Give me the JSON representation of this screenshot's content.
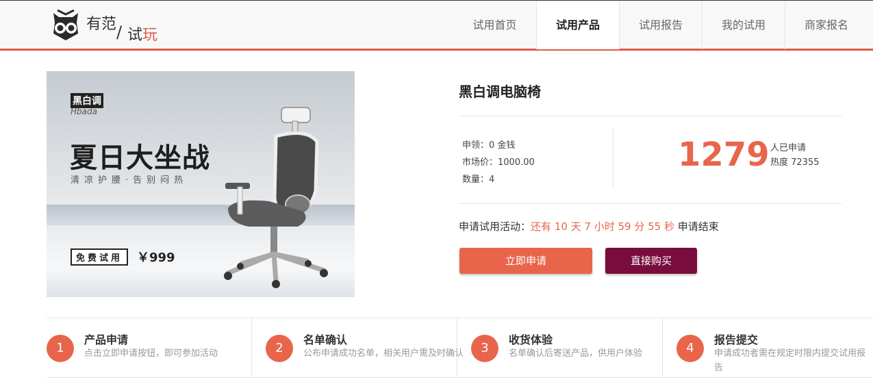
{
  "header": {
    "logo": {
      "text1": "有范",
      "slash": "/",
      "text2a": "试",
      "text2b": "玩"
    },
    "nav": [
      {
        "label": "试用首页"
      },
      {
        "label": "试用产品"
      },
      {
        "label": "试用报告"
      },
      {
        "label": "我的试用"
      },
      {
        "label": "商家报名"
      }
    ]
  },
  "banner": {
    "brand_cn": "黑白调",
    "brand_en": "Hbada",
    "headline": "夏日大坐战",
    "subline": "清凉护腰·告别闷热",
    "free_tag": "免费试用",
    "price": "￥999"
  },
  "product": {
    "title": "黑白调电脑椅",
    "apply_cost": "申领：0 金钱",
    "market_price": "市场价：1000.00",
    "quantity": "数量：4",
    "applicants": "1279",
    "applicants_label": "人已申请",
    "heat": "热度 72355",
    "countdown_prefix": "申请试用活动：",
    "countdown_value": "还有 10 天 7 小时 59 分 55 秒",
    "countdown_suffix": " 申请结束",
    "apply_button": "立即申请",
    "buy_button": "直接购买"
  },
  "steps": [
    {
      "num": "1",
      "title": "产品申请",
      "desc": "点击立即申请按钮，即可参加活动"
    },
    {
      "num": "2",
      "title": "名单确认",
      "desc": "公布申请成功名单，相关用户需及时确认"
    },
    {
      "num": "3",
      "title": "收货体验",
      "desc": "名单确认后寄送产品，供用户体验"
    },
    {
      "num": "4",
      "title": "报告提交",
      "desc": "申请成功者需在规定时限内提交试用报告"
    }
  ],
  "colors": {
    "accent": "#e8654b",
    "buy": "#7a0d3d",
    "header_line": "#e05a4a"
  },
  "icons": {
    "logo_mark": "owl-icon",
    "chair": "office-chair-image"
  }
}
